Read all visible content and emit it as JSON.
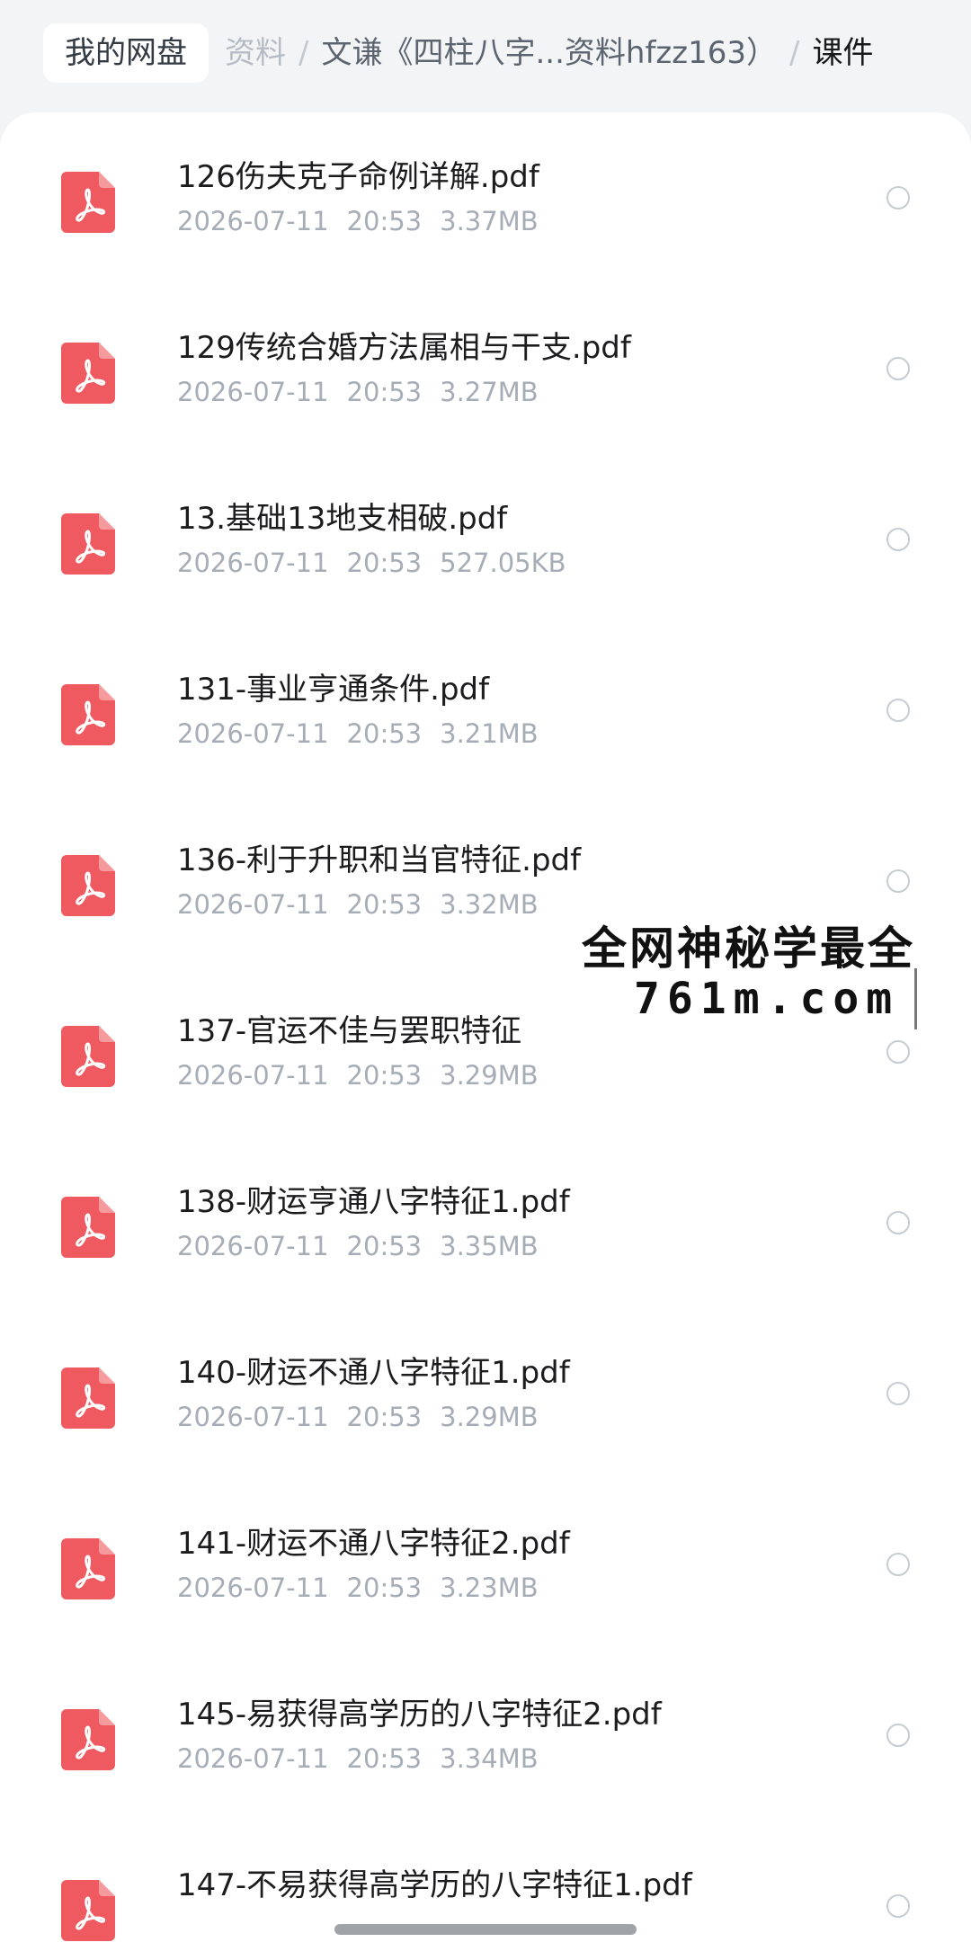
{
  "breadcrumb": {
    "root": "我的网盘",
    "faded_segment": "资料",
    "folder": "文谦《四柱八字...资料hfzz163）",
    "separator": "/",
    "current": "课件"
  },
  "files": [
    {
      "name": "126伤夫克子命例详解.pdf",
      "date": "2026-07-11",
      "time": "20:53",
      "size": "3.37MB"
    },
    {
      "name": "129传统合婚方法属相与干支.pdf",
      "date": "2026-07-11",
      "time": "20:53",
      "size": "3.27MB"
    },
    {
      "name": "13.基础13地支相破.pdf",
      "date": "2026-07-11",
      "time": "20:53",
      "size": "527.05KB"
    },
    {
      "name": "131-事业亨通条件.pdf",
      "date": "2026-07-11",
      "time": "20:53",
      "size": "3.21MB"
    },
    {
      "name": "136-利于升职和当官特征.pdf",
      "date": "2026-07-11",
      "time": "20:53",
      "size": "3.32MB"
    },
    {
      "name": "137-官运不佳与罢职特征",
      "date": "2026-07-11",
      "time": "20:53",
      "size": "3.29MB"
    },
    {
      "name": "138-财运亨通八字特征1.pdf",
      "date": "2026-07-11",
      "time": "20:53",
      "size": "3.35MB"
    },
    {
      "name": "140-财运不通八字特征1.pdf",
      "date": "2026-07-11",
      "time": "20:53",
      "size": "3.29MB"
    },
    {
      "name": "141-财运不通八字特征2.pdf",
      "date": "2026-07-11",
      "time": "20:53",
      "size": "3.23MB"
    },
    {
      "name": "145-易获得高学历的八字特征2.pdf",
      "date": "2026-07-11",
      "time": "20:53",
      "size": "3.34MB"
    },
    {
      "name": "147-不易获得高学历的八字特征1.pdf",
      "date": "",
      "time": "",
      "size": ""
    }
  ],
  "watermark": {
    "line1": "全网神秘学最全",
    "line2": "761m.com"
  },
  "colors": {
    "pdf_icon": "#ee5a5f",
    "background": "#f3f4f6"
  },
  "icons": {
    "file_type": "pdf-icon",
    "selection": "radio-unchecked-icon"
  }
}
